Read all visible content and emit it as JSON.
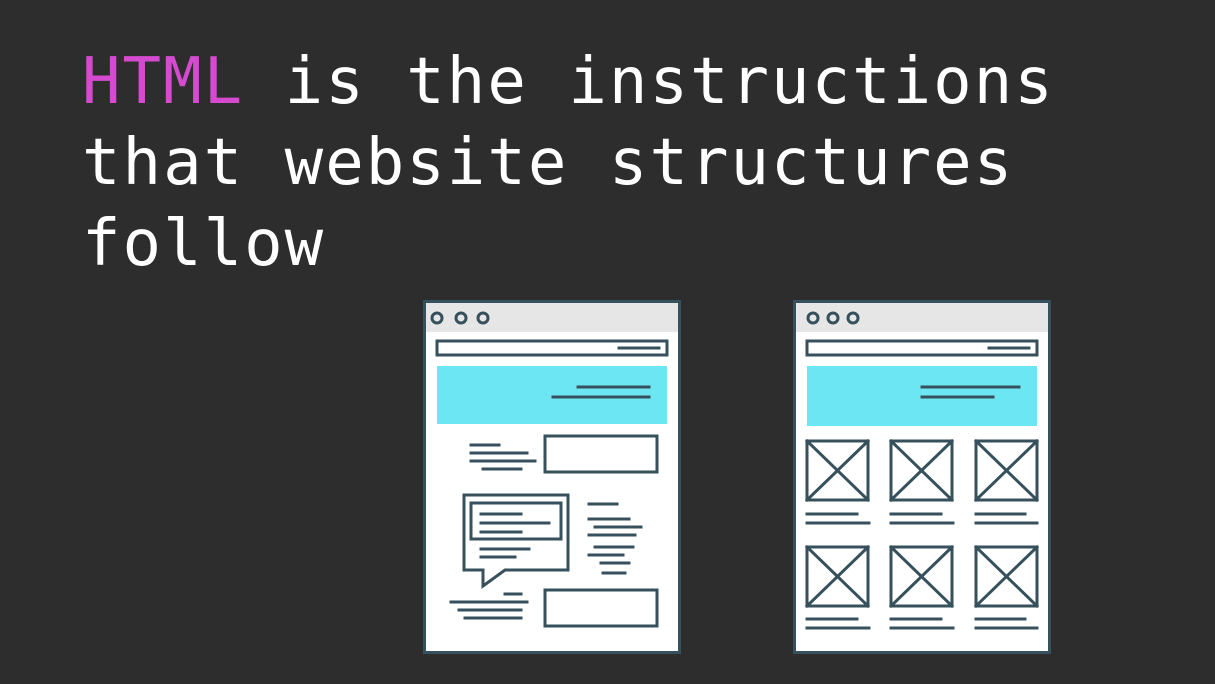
{
  "slide": {
    "headline_accent": "HTML",
    "headline_rest": " is the instructions\nthat website structures\nfollow"
  },
  "illustrations": {
    "left": "content-page-wireframe",
    "right": "image-grid-wireframe"
  },
  "colors": {
    "background": "#2d2d2d",
    "accent_text": "#d44bd0",
    "body_text": "#ffffff",
    "frame_stroke": "#36515c",
    "browser_bar": "#e6e6e6",
    "hero_block": "#6ce6f2",
    "page_fill": "#ffffff"
  }
}
